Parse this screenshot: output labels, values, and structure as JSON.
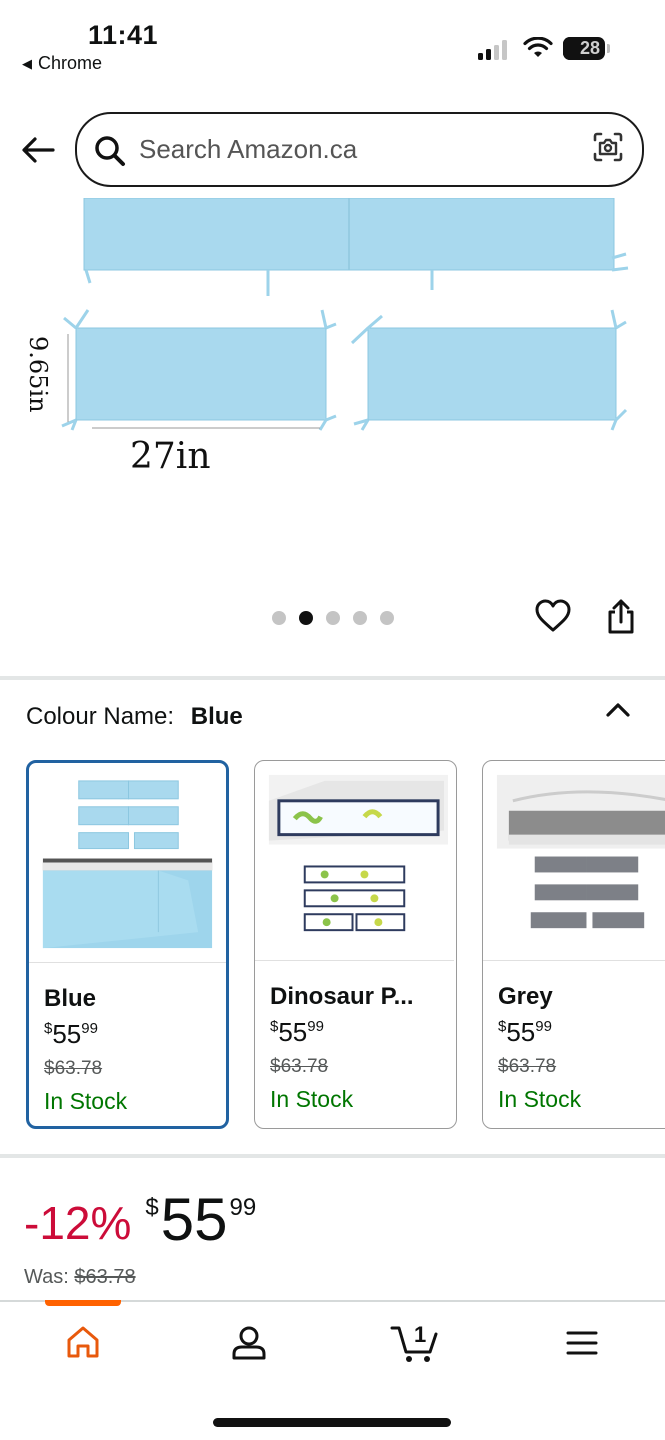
{
  "status_bar": {
    "time": "11:41",
    "back_app": "Chrome",
    "battery": "28"
  },
  "search": {
    "placeholder": "Search Amazon.ca"
  },
  "product_image": {
    "dimension_height": "9.65in",
    "dimension_width": "27in",
    "color": "#a9d9ee",
    "carousel_total": 5,
    "carousel_active_index": 1
  },
  "colour": {
    "label": "Colour Name:",
    "value": "Blue"
  },
  "swatches": [
    {
      "name": "Blue",
      "price_symbol": "$",
      "price_whole": "55",
      "price_fraction": "99",
      "was": "$63.78",
      "stock": "In Stock",
      "selected": true
    },
    {
      "name": "Dinosaur P...",
      "price_symbol": "$",
      "price_whole": "55",
      "price_fraction": "99",
      "was": "$63.78",
      "stock": "In Stock",
      "selected": false
    },
    {
      "name": "Grey",
      "price_symbol": "$",
      "price_whole": "55",
      "price_fraction": "99",
      "was": "$63.78",
      "stock": "In Stock",
      "selected": false
    }
  ],
  "price": {
    "discount": "-12%",
    "symbol": "$",
    "whole": "55",
    "fraction": "99",
    "was_label": "Was:",
    "was_value": "$63.78"
  },
  "bottom_nav": {
    "items": [
      "home-icon",
      "account-icon",
      "cart-icon",
      "menu-icon"
    ],
    "cart_count": "1",
    "accent": "#ff6200"
  }
}
